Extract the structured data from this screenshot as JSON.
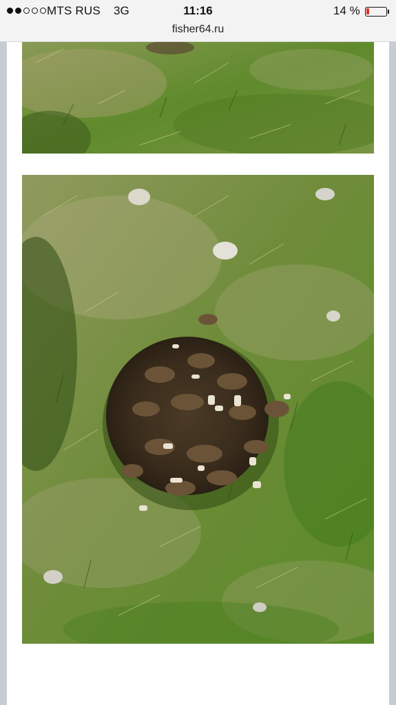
{
  "status_bar": {
    "signal_icon": "signal-dots-icon",
    "signal_strength": 2,
    "signal_max": 5,
    "carrier": "MTS RUS",
    "network": "3G",
    "time": "11:16",
    "battery_percent_label": "14 %",
    "battery_level": 0.14,
    "battery_icon": "battery-icon",
    "battery_color": "#e52d27"
  },
  "browser": {
    "url": "fisher64.ru"
  },
  "content": {
    "images": [
      {
        "name": "grass-photo",
        "description_icon": "photo-image"
      },
      {
        "name": "morels-pile-photo",
        "description_icon": "photo-image"
      }
    ]
  }
}
